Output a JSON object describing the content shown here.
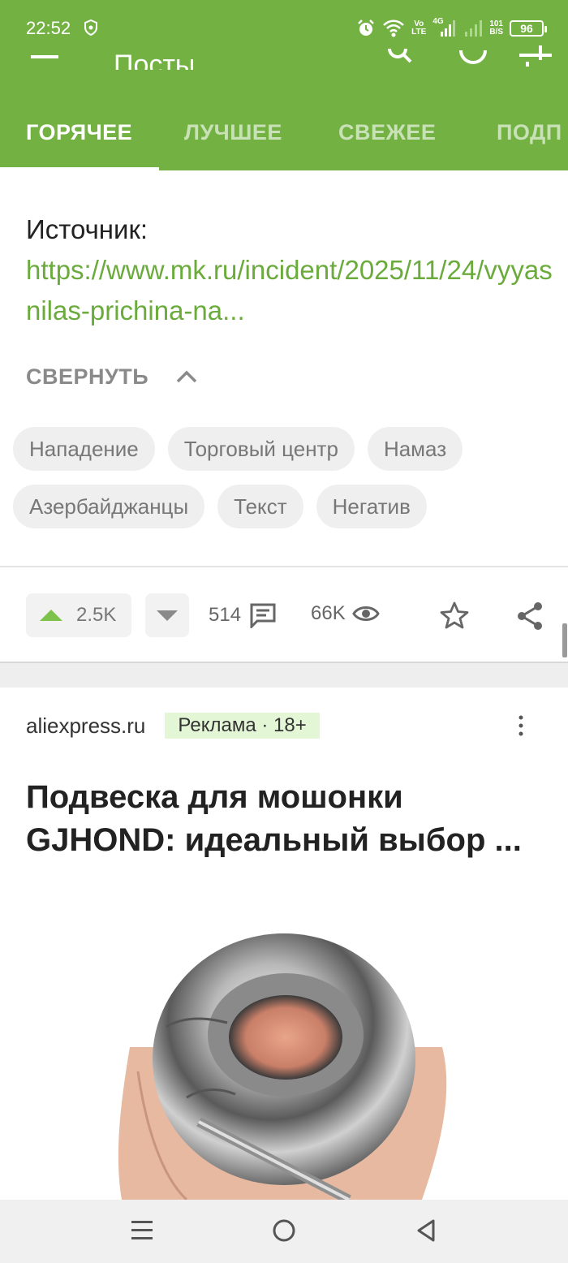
{
  "status_bar": {
    "time": "22:52",
    "network_top": "Vo",
    "network_bottom": "LTE",
    "net_type": "4G",
    "speed_top": "101",
    "speed_bottom": "B/S",
    "battery": "96"
  },
  "toolbar": {
    "title": "Посты",
    "icons": [
      "menu-icon",
      "search-icon",
      "refresh-icon",
      "filter-icon"
    ]
  },
  "tabs": [
    {
      "label": "ГОРЯЧЕЕ",
      "active": true
    },
    {
      "label": "ЛУЧШЕЕ",
      "active": false
    },
    {
      "label": "СВЕЖЕЕ",
      "active": false
    },
    {
      "label": "ПОДП",
      "active": false
    }
  ],
  "post": {
    "source_label": "Источник:",
    "source_link": "https://www.mk.ru/incident/2025/11/24/vyyasnilas-prichina-na...",
    "collapse_label": "СВЕРНУТЬ",
    "tags_row1": [
      "Нападение",
      "Торговый центр",
      "Намаз"
    ],
    "tags_row2": [
      "Азербайджанцы",
      "Текст",
      "Негатив"
    ],
    "rating_up": "2.5K",
    "comments_count": "514",
    "views_count": "66K"
  },
  "ad": {
    "source": "aliexpress.ru",
    "badge": "Реклама · 18+",
    "title": "Подвеска для мошонки GJHOND: идеальный выбор ..."
  },
  "colors": {
    "brand_green": "#72b142",
    "link_green": "#6aab3c",
    "vote_up_green": "#7dc24b",
    "ad_badge_bg": "#e3f7d6"
  }
}
